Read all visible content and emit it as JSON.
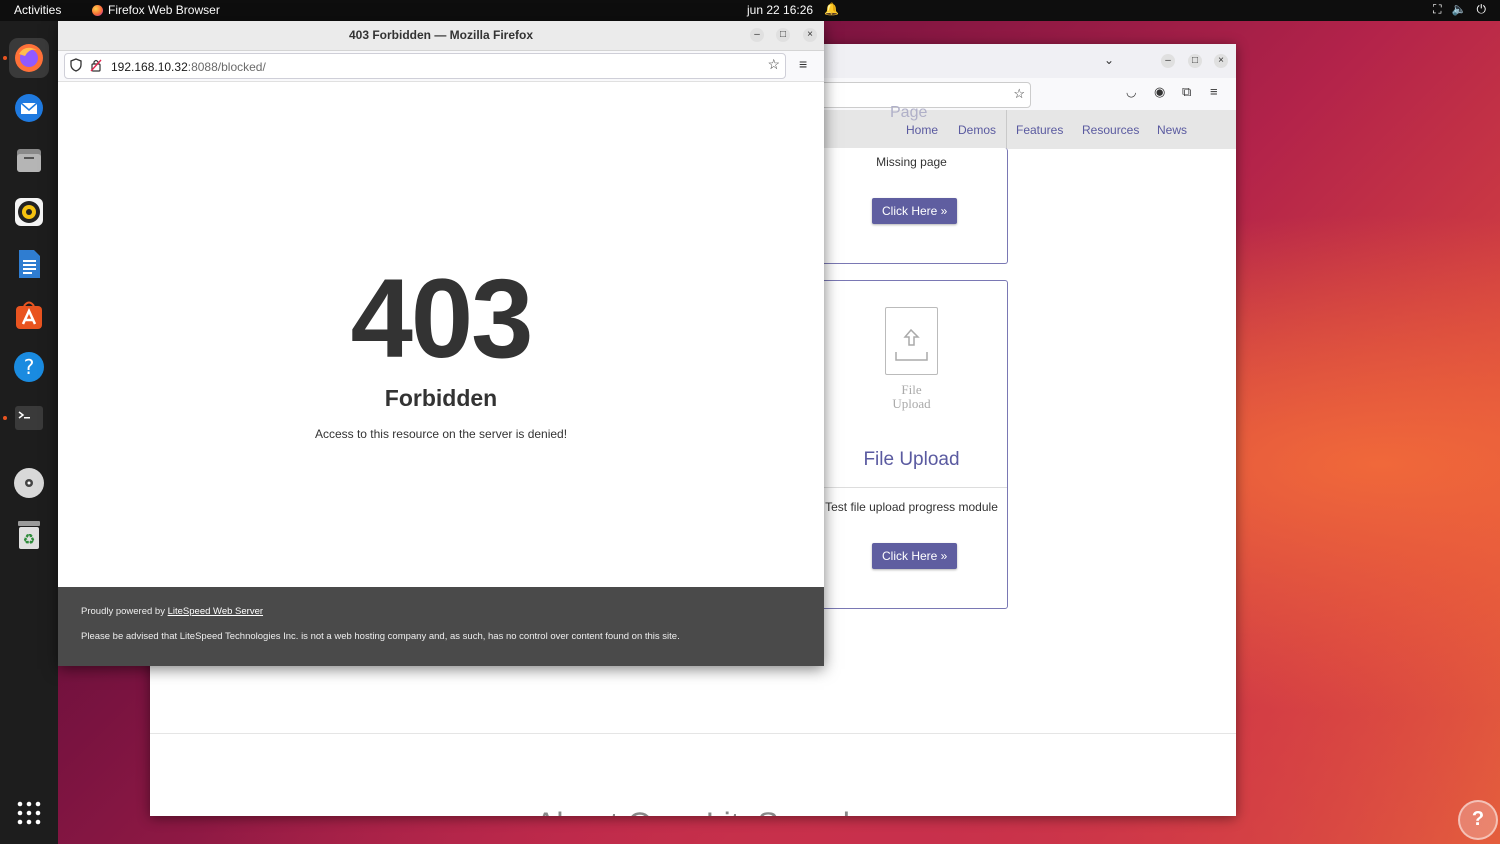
{
  "topbar": {
    "activities": "Activities",
    "app_name": "Firefox Web Browser",
    "clock": "jun 22  16:26"
  },
  "dock": {
    "items": [
      "firefox",
      "thunderbird",
      "files",
      "rhythmbox",
      "libreoffice-writer",
      "app-center",
      "help",
      "terminal",
      "disc",
      "trash",
      "show-apps"
    ]
  },
  "back_window": {
    "nav_page_partial": "Page",
    "nav": [
      "Home",
      "Demos",
      "Features",
      "Resources",
      "News"
    ],
    "card1": {
      "text": "Missing page",
      "button": "Click Here »"
    },
    "card2": {
      "icon_caption_1": "File",
      "icon_caption_2": "Upload",
      "title": "File Upload",
      "text": "Test file upload progress module",
      "button": "Click Here »"
    },
    "partial_heading": "About OpenLiteSpeed"
  },
  "front_window": {
    "title": "403 Forbidden — Mozilla Firefox",
    "url_host": "192.168.10.32",
    "url_rest": ":8088/blocked/",
    "code": "403",
    "heading": "Forbidden",
    "message": "Access to this resource on the server is denied!",
    "footer": {
      "powered_prefix": "Proudly powered by ",
      "powered_link": "LiteSpeed Web Server",
      "advisory": "Please be advised that LiteSpeed Technologies Inc. is not a web hosting company and, as such, has no control over content found on this site."
    }
  }
}
